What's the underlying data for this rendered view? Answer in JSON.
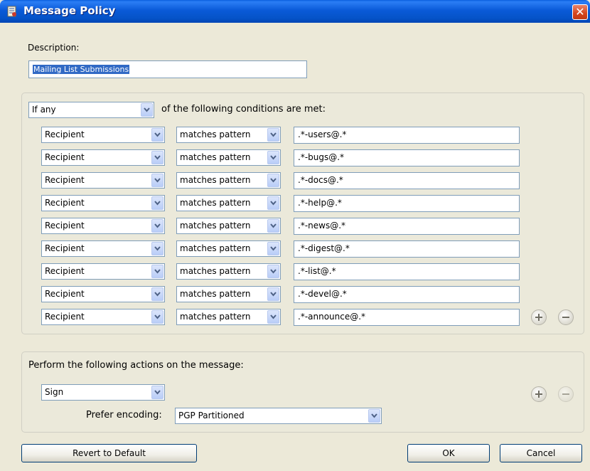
{
  "window": {
    "title": "Message Policy",
    "close_glyph": "✕"
  },
  "description": {
    "label": "Description:",
    "value": "Mailing List Submissions"
  },
  "conditions": {
    "match_mode": "If any",
    "suffix": "of the following conditions are met:",
    "rows": [
      {
        "field": "Recipient",
        "operator": "matches pattern",
        "value": ".*-users@.*"
      },
      {
        "field": "Recipient",
        "operator": "matches pattern",
        "value": ".*-bugs@.*"
      },
      {
        "field": "Recipient",
        "operator": "matches pattern",
        "value": ".*-docs@.*"
      },
      {
        "field": "Recipient",
        "operator": "matches pattern",
        "value": ".*-help@.*"
      },
      {
        "field": "Recipient",
        "operator": "matches pattern",
        "value": ".*-news@.*"
      },
      {
        "field": "Recipient",
        "operator": "matches pattern",
        "value": ".*-digest@.*"
      },
      {
        "field": "Recipient",
        "operator": "matches pattern",
        "value": ".*-list@.*"
      },
      {
        "field": "Recipient",
        "operator": "matches pattern",
        "value": ".*-devel@.*"
      },
      {
        "field": "Recipient",
        "operator": "matches pattern",
        "value": ".*-announce@.*"
      }
    ]
  },
  "actions": {
    "heading": "Perform the following actions on the message:",
    "action": "Sign",
    "encoding_label": "Prefer encoding:",
    "encoding": "PGP Partitioned"
  },
  "buttons": {
    "revert": "Revert to Default",
    "ok": "OK",
    "cancel": "Cancel"
  },
  "icons": {
    "add": "plus-icon",
    "remove": "minus-icon",
    "dropdown": "chevron-down-icon",
    "window": "policy-document-icon"
  }
}
